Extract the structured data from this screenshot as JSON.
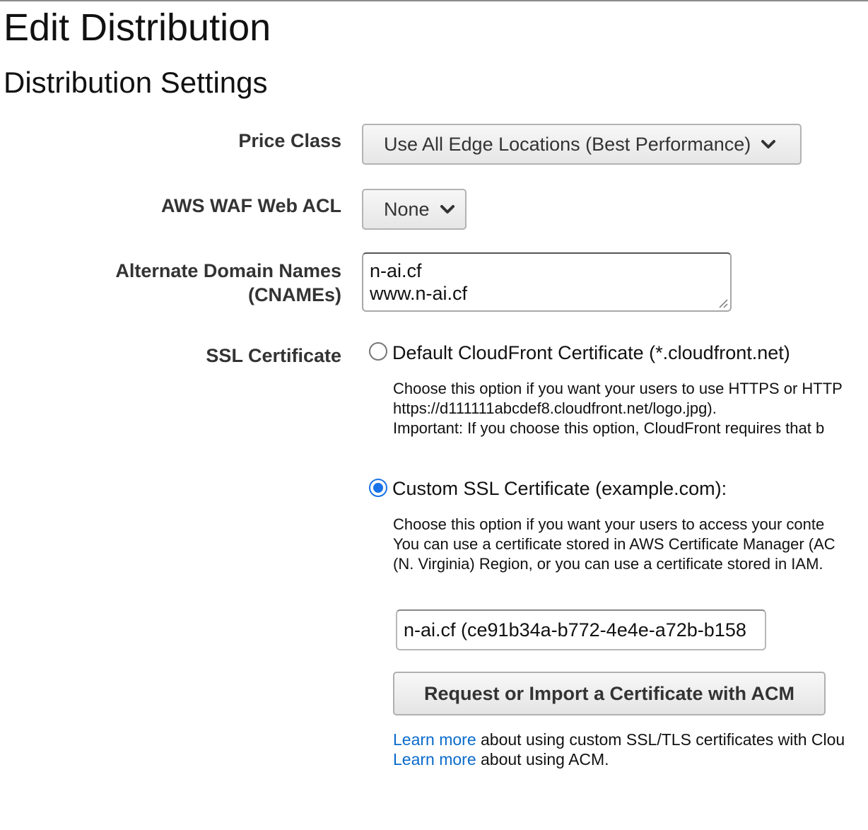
{
  "page": {
    "title": "Edit Distribution",
    "section_title": "Distribution Settings"
  },
  "price_class": {
    "label": "Price Class",
    "selected": "Use All Edge Locations (Best Performance)"
  },
  "waf": {
    "label": "AWS WAF Web ACL",
    "selected": "None"
  },
  "cnames": {
    "label_line1": "Alternate Domain Names",
    "label_line2": "(CNAMEs)",
    "line1": "n-ai.cf",
    "line2": "www.n-ai.cf"
  },
  "ssl": {
    "label": "SSL Certificate",
    "default_option": {
      "label": "Default CloudFront Certificate (*.cloudfront.net)",
      "checked": false,
      "desc_line1": "Choose this option if you want your users to use HTTPS or HTTP",
      "desc_line2": "https://d111111abcdef8.cloudfront.net/logo.jpg).",
      "desc_line3": "Important: If you choose this option, CloudFront requires that b"
    },
    "custom_option": {
      "label": "Custom SSL Certificate (example.com):",
      "checked": true,
      "desc_line1": "Choose this option if you want your users to access your conte",
      "desc_line2": "You can use a certificate stored in AWS Certificate Manager (AC",
      "desc_line3": "(N. Virginia) Region, or you can use a certificate stored in IAM."
    },
    "certificate_value": "n-ai.cf (ce91b34a-b772-4e4e-a72b-b158",
    "acm_button": "Request or Import a Certificate with ACM",
    "learn_more_1_link": "Learn more",
    "learn_more_1_text": " about using custom SSL/TLS certificates with Clou",
    "learn_more_2_link": "Learn more",
    "learn_more_2_text": " about using ACM."
  },
  "colors": {
    "link": "#0b6bcb",
    "radio_checked": "#1a73e8"
  }
}
